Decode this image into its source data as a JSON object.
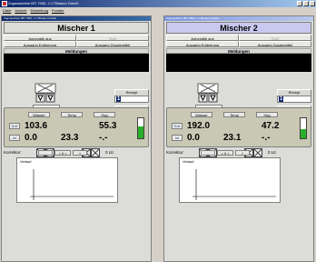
{
  "app": {
    "title": "Zugmaschine IBT 7000, J.J.Tillmann GmbH"
  },
  "menu": [
    "Datei",
    "Ansicht",
    "Einstellung",
    "Fenster"
  ],
  "mixers": [
    {
      "window_title": "Zugmaschine IBT 7000, J.J.Tillmann GmbH",
      "name": "Mischer 1",
      "btn_auto": "Automatik aus",
      "btn_start": "Start",
      "btn_entleerung": "Ausgang Entleerung",
      "btn_zusatz": "Ausgang Zusatzmittel",
      "meldungen": "Meldungen",
      "rezept_label": "Rezept",
      "rezept_value": "1",
      "menge_label": "Menge [%]",
      "menge_value": "100",
      "wz_label": "W/Z-Faktor",
      "wz_value": "0.333",
      "tank_name": "Recycling",
      "tank_capacity": "100Kg",
      "tank_weight": "46Kg",
      "hdr_wasser": "Wasser",
      "hdr_temp": "Temp",
      "hdr_hyg": "Hyg",
      "row_soll": "Soll",
      "row_ist": "Ist",
      "soll_wasser": "103.6",
      "soll_hyg": "55.3",
      "ist_wasser": "0.0",
      "ist_temp": "23.3",
      "ist_hyg": "-.-",
      "bar_level": 0.6,
      "korrektur_label": "Korrektur:",
      "kor_minus": "-",
      "kor_zero": "> 0 <",
      "kor_plus": "+",
      "kor_value": "0 Ltr.",
      "verlauf": "Verlauf"
    },
    {
      "window_title": "Zugmaschine IBT 7000, J.J.Tillmann GmbH",
      "name": "Mischer 2",
      "btn_auto": "Automatik aus",
      "btn_start": "Start",
      "btn_entleerung": "Ausgang Entleerung",
      "btn_zusatz": "Ausgang Zusatzmittel",
      "meldungen": "Meldungen",
      "rezept_label": "Rezept",
      "rezept_value": "1",
      "menge_label": "Menge [%]",
      "menge_value": "100",
      "wz_label": "W/Z-Faktor",
      "wz_value": "0.320",
      "tank_name": "Recycling",
      "tank_capacity": "100Kg",
      "tank_weight": "67Kg",
      "hdr_wasser": "Wasser",
      "hdr_temp": "Temp",
      "hdr_hyg": "Hyg",
      "row_soll": "Soll",
      "row_ist": "Ist",
      "soll_wasser": "192.0",
      "soll_hyg": "47.2",
      "ist_wasser": "0.0",
      "ist_temp": "23.1",
      "ist_hyg": "-.-",
      "bar_level": 0.45,
      "korrektur_label": "Korrektur:",
      "kor_minus": "-",
      "kor_zero": "> 0 <",
      "kor_plus": "+",
      "kor_value": "0 Ltr.",
      "verlauf": "Verlauf"
    }
  ],
  "colors": {
    "title_active": "#0a246a",
    "mischer2_header": "#c8c8f0",
    "tank_red": "#d02040",
    "bar_green": "#28b028"
  }
}
